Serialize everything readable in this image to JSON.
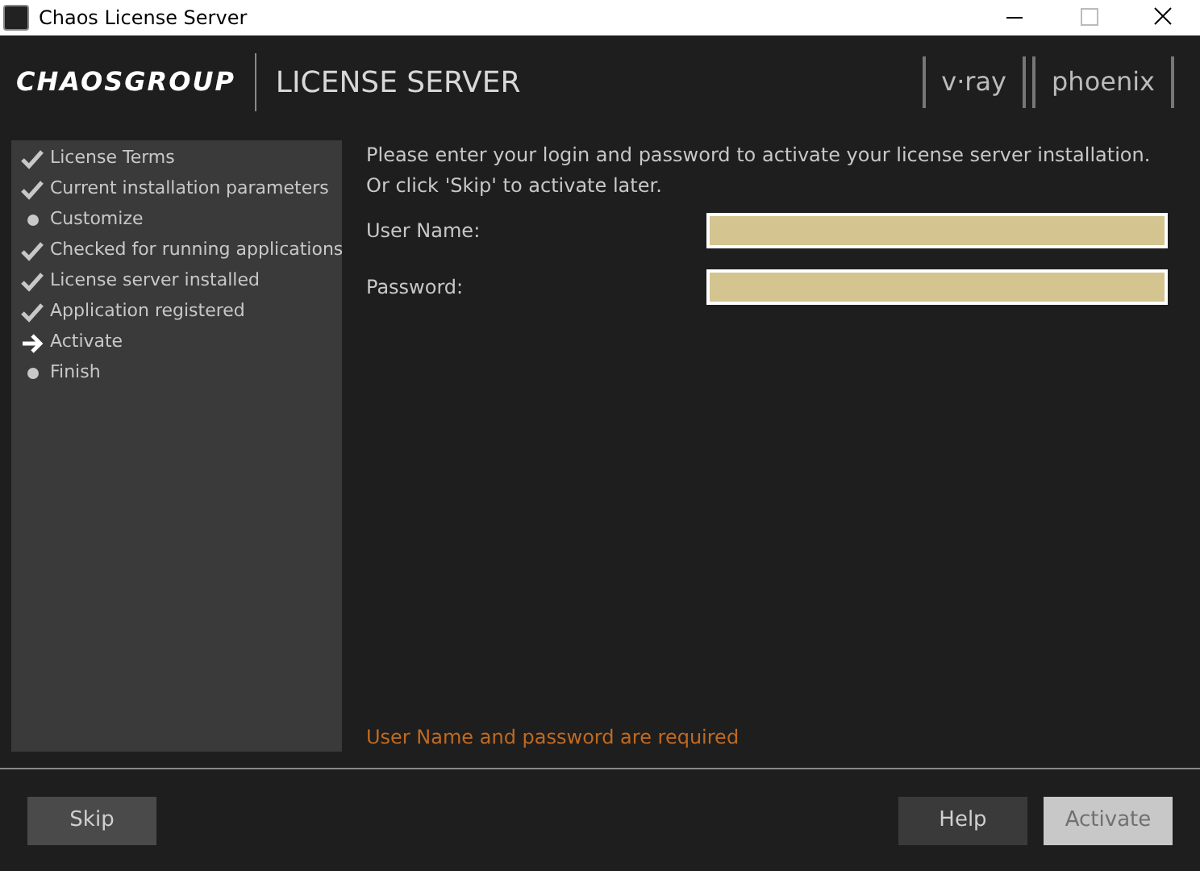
{
  "window": {
    "title": "Chaos License Server"
  },
  "header": {
    "logo": "CHAOSGROUP",
    "title": "LICENSE SERVER",
    "product_logos": [
      "v·ray",
      "phoenix"
    ]
  },
  "steps": [
    {
      "label": "License Terms",
      "kind": "done"
    },
    {
      "label": "Current installation parameters",
      "kind": "done"
    },
    {
      "label": "Customize",
      "kind": "pending"
    },
    {
      "label": "Checked for running applications",
      "kind": "done"
    },
    {
      "label": "License server installed",
      "kind": "done"
    },
    {
      "label": "Application registered",
      "kind": "done"
    },
    {
      "label": "Activate",
      "kind": "current"
    },
    {
      "label": "Finish",
      "kind": "pending"
    }
  ],
  "intro": [
    "Please enter your login and password to activate your license server installation.",
    "Or click 'Skip' to activate later."
  ],
  "fields": [
    {
      "label": "User Name:"
    },
    {
      "label": "Password:"
    }
  ],
  "error": "User Name and password are required",
  "buttons": [
    {
      "label": "Skip",
      "kind": "secondary",
      "disabled": false
    },
    {
      "label": "Help",
      "kind": "normal",
      "disabled": false
    },
    {
      "label": "Activate",
      "kind": "primary",
      "disabled": true
    }
  ]
}
